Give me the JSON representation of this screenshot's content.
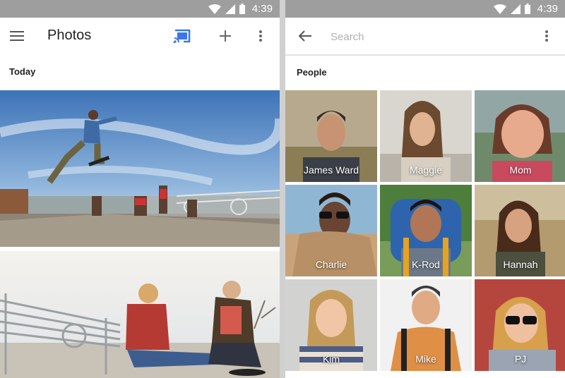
{
  "status_bar": {
    "time": "4:39"
  },
  "photos_screen": {
    "title": "Photos",
    "section": "Today",
    "icons": {
      "menu": "menu-icon",
      "cast": "cast-icon",
      "add": "plus-icon",
      "more": "more-vert-icon"
    },
    "colors": {
      "cast": "#3b78e7",
      "statusbar": "#9e9e9e"
    }
  },
  "people_screen": {
    "search_placeholder": "Search",
    "section": "People",
    "people": [
      {
        "name": "James Ward"
      },
      {
        "name": "Maggie"
      },
      {
        "name": "Mom"
      },
      {
        "name": "Charlie"
      },
      {
        "name": "K-Rod"
      },
      {
        "name": "Hannah"
      },
      {
        "name": "Kim"
      },
      {
        "name": "Mike"
      },
      {
        "name": "PJ"
      }
    ]
  }
}
